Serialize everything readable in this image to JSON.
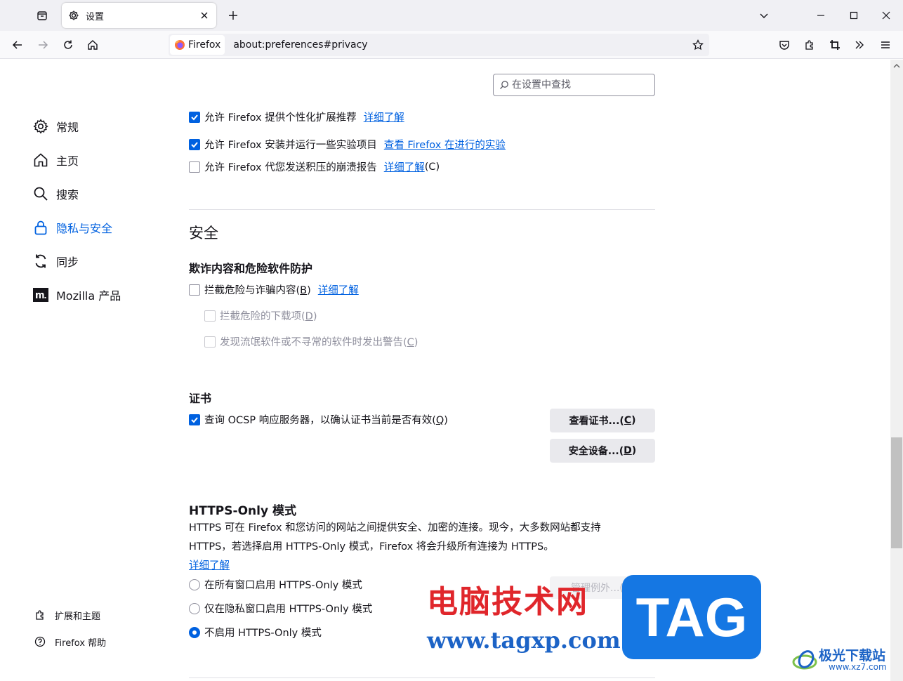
{
  "tabbar": {
    "tab_title": "设置",
    "list_all_tabs": "list-all-tabs",
    "new_tab": "+"
  },
  "navbar": {
    "identity_label": "Firefox",
    "url": "about:preferences#privacy"
  },
  "search": {
    "placeholder": "在设置中查找"
  },
  "sidebar": {
    "items": [
      {
        "label": "常规",
        "icon": "gear-icon"
      },
      {
        "label": "主页",
        "icon": "home-icon"
      },
      {
        "label": "搜索",
        "icon": "search-icon"
      },
      {
        "label": "隐私与安全",
        "icon": "lock-icon",
        "active": true
      },
      {
        "label": "同步",
        "icon": "sync-icon"
      },
      {
        "label": "Mozilla 产品",
        "icon": "mozilla-icon"
      }
    ],
    "footer": {
      "extensions": "扩展和主题",
      "help": "Firefox 帮助"
    }
  },
  "data_collection": {
    "partial_row": "允许 Firefox 提供个性化扩展推荐",
    "partial_link": "详细了解",
    "studies_label": "允许 Firefox 安装并运行一些实验项目",
    "studies_link": "查看 Firefox 在进行的实验",
    "crash_label": "允许 Firefox 代您发送积压的崩溃报告",
    "crash_link": "详细了解",
    "crash_link_key": "(C)"
  },
  "security": {
    "title": "安全",
    "phishing_heading": "欺诈内容和危险软件防护",
    "block_dangerous": "拦截危险与诈骗内容(",
    "block_dangerous_key": "B",
    "block_dangerous_link": "详细了解",
    "block_downloads": "拦截危险的下载项(",
    "block_downloads_key": "D",
    "warn_unwanted": "发现流氓软件或不寻常的软件时发出警告(",
    "warn_unwanted_key": "C",
    "cert_heading": "证书",
    "ocsp_label": "查询 OCSP 响应服务器，以确认证书当前是否有效(",
    "ocsp_key": "Q",
    "view_certs": "查看证书...(",
    "view_certs_key": "C",
    "security_devices": "安全设备...(",
    "security_devices_key": "D"
  },
  "https_only": {
    "heading": "HTTPS-Only 模式",
    "desc_line1": "HTTPS 可在 Firefox 和您访问的网站之间提供安全、加密的连接。现今，大多数网站都支持",
    "desc_line2": "HTTPS，若选择启用 HTTPS-Only 模式，Firefox 将会升级所有连接为 HTTPS。",
    "learn_more": "详细了解",
    "option_all": "在所有窗口启用 HTTPS-Only 模式",
    "option_private": "仅在隐私窗口启用 HTTPS-Only 模式",
    "option_off": "不启用 HTTPS-Only 模式",
    "manage_exceptions": "管理例外...(X)"
  },
  "watermark": {
    "cn": "电脑技术网",
    "url": "www.tagxp.com",
    "tag": "TAG",
    "site_name": "极光下载站",
    "site_url": "www.xz7.com"
  },
  "colors": {
    "accent": "#0061e0",
    "watermark_red": "#e0262b",
    "watermark_blue": "#1577e3"
  }
}
